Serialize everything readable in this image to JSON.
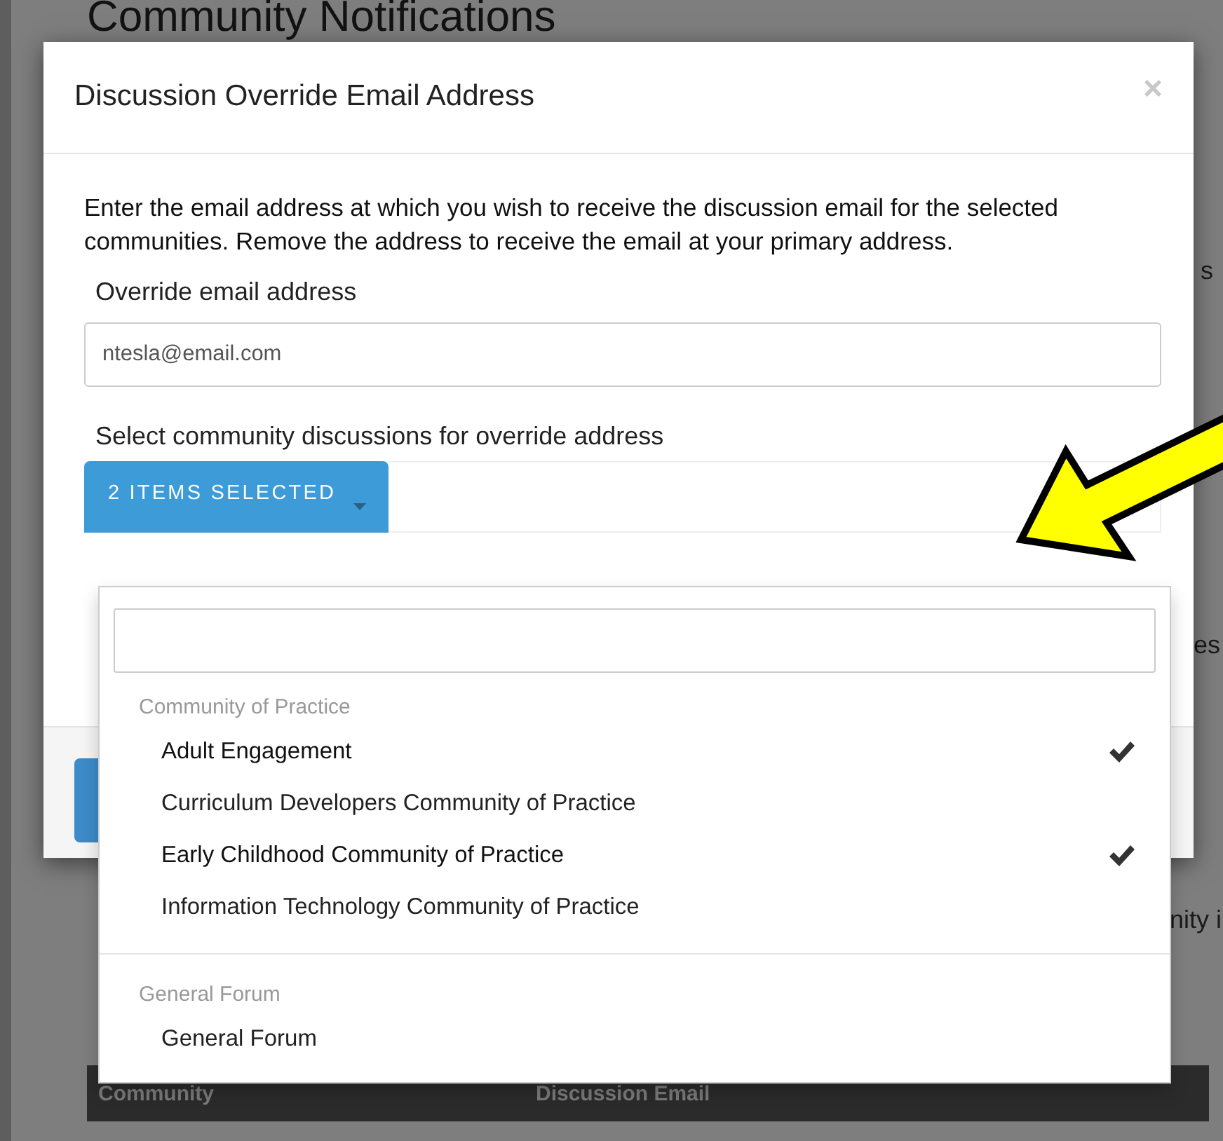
{
  "background": {
    "title": "Community Notifications",
    "fragments": [
      "s",
      "es",
      "nity i"
    ],
    "table_columns": [
      "Community",
      "Discussion Email"
    ]
  },
  "dialog": {
    "title": "Discussion Override Email Address",
    "close": "×",
    "intro": "Enter the email address at which you wish to receive the discussion email for the selected communities. Remove the address to receive the email at your primary address.",
    "email_label": "Override email address",
    "email_value": "ntesla@email.com",
    "select_label": "Select community discussions for override address",
    "multiselect": {
      "button": "2 ITEMS SELECTED",
      "groups": [
        {
          "label": "Community of Practice",
          "items": [
            {
              "label": "Adult Engagement",
              "selected": true
            },
            {
              "label": "Curriculum Developers Community of Practice",
              "selected": false
            },
            {
              "label": "Early Childhood Community of Practice",
              "selected": true
            },
            {
              "label": "Information Technology Community of Practice",
              "selected": false
            }
          ]
        },
        {
          "label": "General Forum",
          "items": [
            {
              "label": "General Forum",
              "selected": false
            }
          ]
        }
      ]
    }
  }
}
